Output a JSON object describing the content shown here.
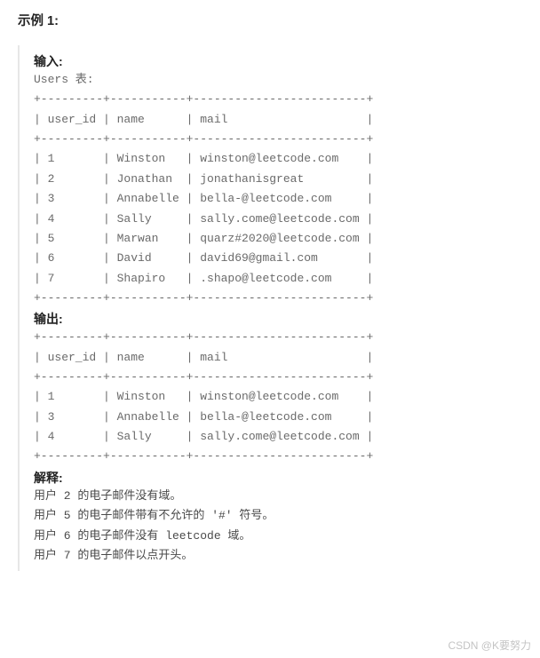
{
  "title": "示例 1:",
  "labels": {
    "input": "输入:",
    "output": "输出:",
    "explain": "解释:"
  },
  "input_table_name": "Users 表:",
  "input_table": {
    "sep": "+---------+-----------+-------------------------+",
    "head": "| user_id | name      | mail                    |",
    "rows": [
      "| 1       | Winston   | winston@leetcode.com    |",
      "| 2       | Jonathan  | jonathanisgreat         |",
      "| 3       | Annabelle | bella-@leetcode.com     |",
      "| 4       | Sally     | sally.come@leetcode.com |",
      "| 5       | Marwan    | quarz#2020@leetcode.com |",
      "| 6       | David     | david69@gmail.com       |",
      "| 7       | Shapiro   | .shapo@leetcode.com     |"
    ]
  },
  "output_table": {
    "sep": "+---------+-----------+-------------------------+",
    "head": "| user_id | name      | mail                    |",
    "rows": [
      "| 1       | Winston   | winston@leetcode.com    |",
      "| 3       | Annabelle | bella-@leetcode.com     |",
      "| 4       | Sally     | sally.come@leetcode.com |"
    ]
  },
  "explain_lines": [
    "用户 2 的电子邮件没有域。",
    "用户 5 的电子邮件带有不允许的 '#' 符号。",
    "用户 6 的电子邮件没有 leetcode 域。",
    "用户 7 的电子邮件以点开头。"
  ],
  "watermark": "CSDN @K要努力",
  "chart_data": {
    "type": "table",
    "input": {
      "columns": [
        "user_id",
        "name",
        "mail"
      ],
      "rows": [
        [
          1,
          "Winston",
          "winston@leetcode.com"
        ],
        [
          2,
          "Jonathan",
          "jonathanisgreat"
        ],
        [
          3,
          "Annabelle",
          "bella-@leetcode.com"
        ],
        [
          4,
          "Sally",
          "sally.come@leetcode.com"
        ],
        [
          5,
          "Marwan",
          "quarz#2020@leetcode.com"
        ],
        [
          6,
          "David",
          "david69@gmail.com"
        ],
        [
          7,
          "Shapiro",
          ".shapo@leetcode.com"
        ]
      ]
    },
    "output": {
      "columns": [
        "user_id",
        "name",
        "mail"
      ],
      "rows": [
        [
          1,
          "Winston",
          "winston@leetcode.com"
        ],
        [
          3,
          "Annabelle",
          "bella-@leetcode.com"
        ],
        [
          4,
          "Sally",
          "sally.come@leetcode.com"
        ]
      ]
    }
  }
}
